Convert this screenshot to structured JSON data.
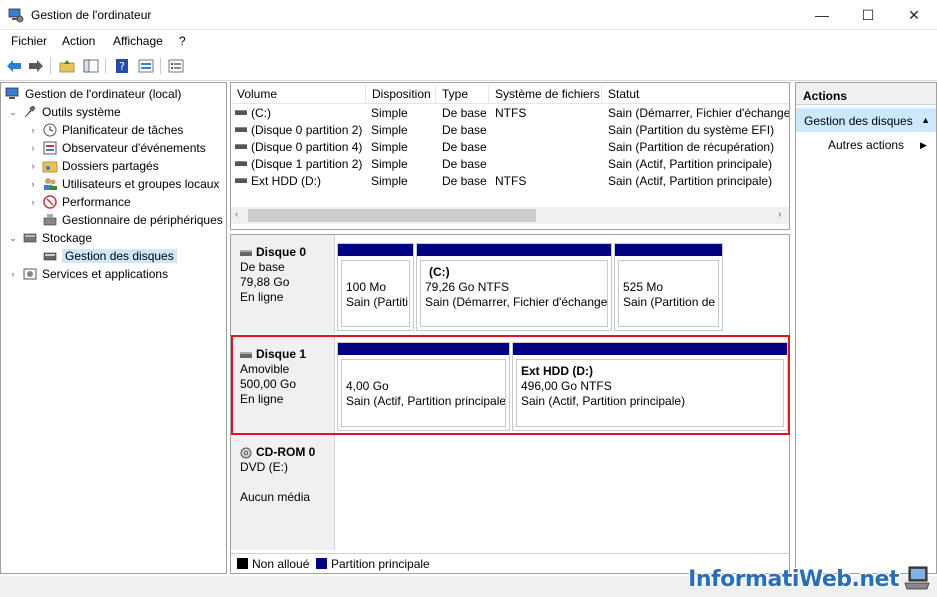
{
  "window": {
    "title": "Gestion de l'ordinateur",
    "minimize": "—",
    "maximize": "☐",
    "close": "✕"
  },
  "menu": [
    "Fichier",
    "Action",
    "Affichage",
    "?"
  ],
  "tree": {
    "root": "Gestion de l'ordinateur (local)",
    "outils": "Outils système",
    "planificateur": "Planificateur de tâches",
    "observateur": "Observateur d'événements",
    "dossiers": "Dossiers partagés",
    "utilisateurs": "Utilisateurs et groupes locaux",
    "performance": "Performance",
    "peripheriques": "Gestionnaire de périphériques",
    "stockage": "Stockage",
    "disques": "Gestion des disques",
    "services": "Services et applications"
  },
  "volumes": {
    "headers": [
      "Volume",
      "Disposition",
      "Type",
      "Système de fichiers",
      "Statut"
    ],
    "rows": [
      [
        "(C:)",
        "Simple",
        "De base",
        "NTFS",
        "Sain (Démarrer, Fichier d'échange,"
      ],
      [
        "(Disque 0 partition 2)",
        "Simple",
        "De base",
        "",
        "Sain (Partition du système EFI)"
      ],
      [
        "(Disque 0 partition 4)",
        "Simple",
        "De base",
        "",
        "Sain (Partition de récupération)"
      ],
      [
        "(Disque 1 partition 2)",
        "Simple",
        "De base",
        "",
        "Sain (Actif, Partition principale)"
      ],
      [
        "Ext HDD (D:)",
        "Simple",
        "De base",
        "NTFS",
        "Sain (Actif, Partition principale)"
      ]
    ]
  },
  "disks": {
    "d0": {
      "name": "Disque 0",
      "type": "De base",
      "size": "79,88 Go",
      "status": "En ligne",
      "p1": {
        "title": "",
        "size": "100 Mo",
        "status": "Sain (Partiti"
      },
      "p2": {
        "title": "(C:)",
        "size": "79,26 Go NTFS",
        "status": "Sain (Démarrer, Fichier d'échange,"
      },
      "p3": {
        "title": "",
        "size": "525 Mo",
        "status": "Sain (Partition de r"
      }
    },
    "d1": {
      "name": "Disque 1",
      "type": "Amovible",
      "size": "500,00 Go",
      "status": "En ligne",
      "p1": {
        "size": "4,00 Go",
        "status": "Sain (Actif, Partition principale"
      },
      "p2": {
        "title": "Ext HDD  (D:)",
        "size": "496,00 Go NTFS",
        "status": "Sain (Actif, Partition principale)"
      }
    },
    "cd": {
      "name": "CD-ROM 0",
      "type": "DVD (E:)",
      "media": "Aucun média"
    }
  },
  "legend": {
    "unallocated": "Non alloué",
    "primary": "Partition principale",
    "unallocated_color": "#000000",
    "primary_color": "#000080"
  },
  "actions": {
    "header": "Actions",
    "selected": "Gestion des disques",
    "more": "Autres actions"
  },
  "watermark": "InformatiWeb.net"
}
